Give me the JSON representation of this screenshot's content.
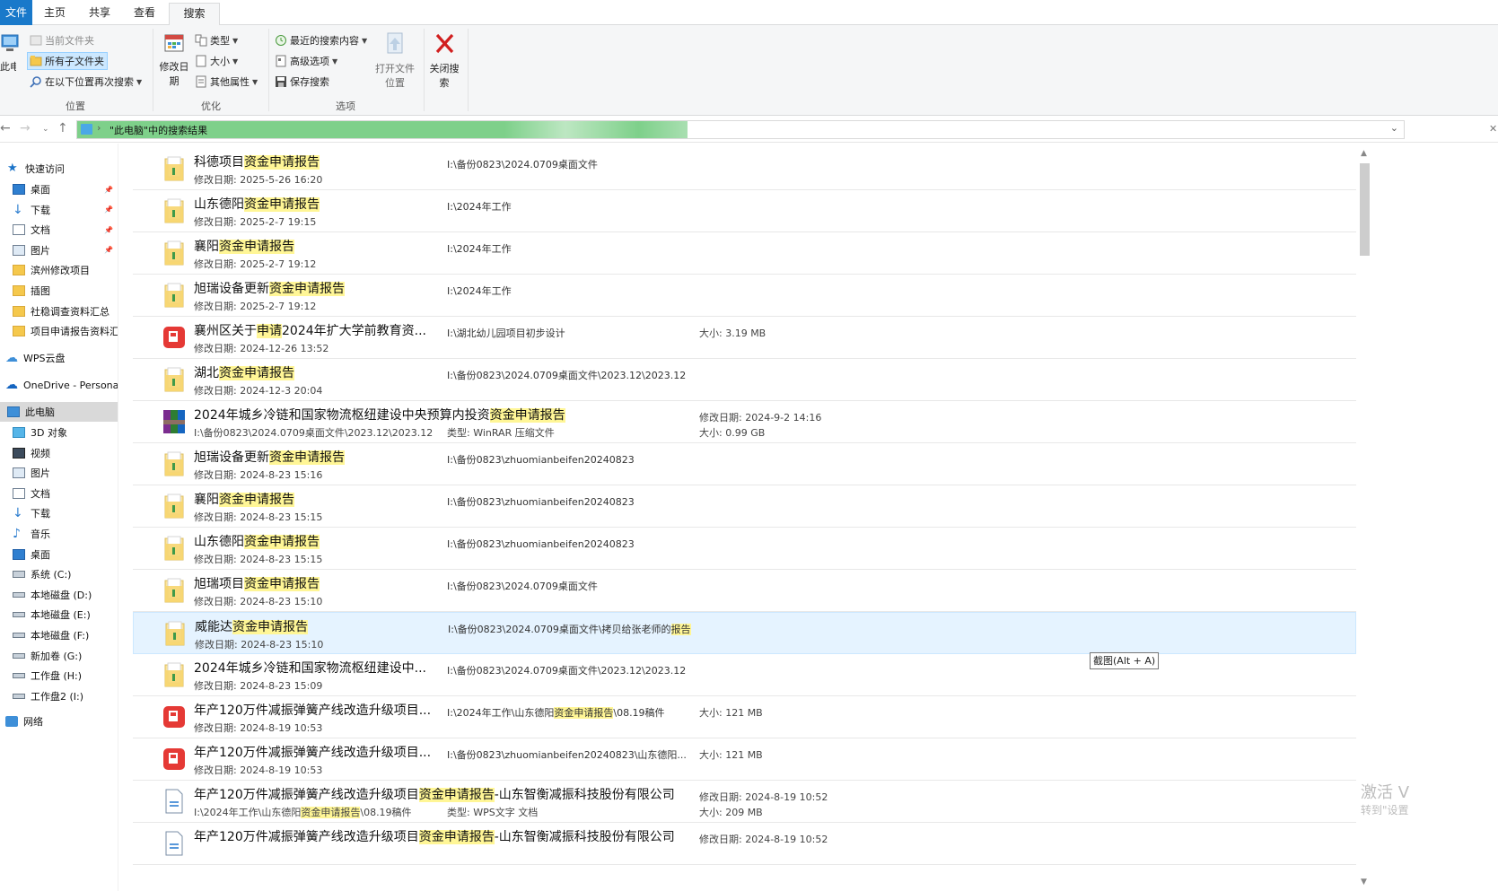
{
  "ribbon_tabs": [
    {
      "label": "文件"
    },
    {
      "label": "主页"
    },
    {
      "label": "共享"
    },
    {
      "label": "查看"
    },
    {
      "label": "搜索"
    }
  ],
  "ribbon": {
    "location": {
      "this_pc": "此电脑",
      "current_folder": "当前文件夹",
      "all_subfolders": "所有子文件夹",
      "search_again_in": "在以下位置再次搜索",
      "group_label": "位置"
    },
    "refine": {
      "date_modified": "修改日期",
      "kind": "类型",
      "size": "大小",
      "other_properties": "其他属性",
      "group_label": "优化"
    },
    "options": {
      "recent_searches": "最近的搜索内容",
      "advanced_options": "高级选项",
      "save_search": "保存搜索",
      "open_file_location": "打开文件位置",
      "group_label": "选项"
    },
    "close": {
      "close_search": "关闭搜索"
    }
  },
  "address_bar": {
    "text": "\"此电脑\"中的搜索结果"
  },
  "nav_pane": {
    "quick_access": "快速访问",
    "quick_items": [
      {
        "label": "桌面",
        "icon": "desktop-icon",
        "pinned": true
      },
      {
        "label": "下载",
        "icon": "download-icon",
        "pinned": true
      },
      {
        "label": "文档",
        "icon": "document-icon",
        "pinned": true
      },
      {
        "label": "图片",
        "icon": "picture-icon",
        "pinned": true
      },
      {
        "label": "滨州修改项目",
        "icon": "folder-icon",
        "pinned": false
      },
      {
        "label": "插图",
        "icon": "folder-icon",
        "pinned": false
      },
      {
        "label": "社稳调查资料汇总",
        "icon": "folder-icon",
        "pinned": false
      },
      {
        "label": "项目申请报告资料汇总",
        "icon": "folder-icon",
        "pinned": false
      }
    ],
    "wps_cloud": "WPS云盘",
    "onedrive": "OneDrive - Personal",
    "this_pc": "此电脑",
    "pc_items": [
      {
        "label": "3D 对象",
        "icon": "3d-objects-icon"
      },
      {
        "label": "视频",
        "icon": "video-icon"
      },
      {
        "label": "图片",
        "icon": "picture-icon"
      },
      {
        "label": "文档",
        "icon": "document-icon"
      },
      {
        "label": "下载",
        "icon": "download-icon"
      },
      {
        "label": "音乐",
        "icon": "music-icon"
      },
      {
        "label": "桌面",
        "icon": "desktop-icon"
      },
      {
        "label": "系统 (C:)",
        "icon": "system-drive-icon"
      },
      {
        "label": "本地磁盘 (D:)",
        "icon": "drive-icon"
      },
      {
        "label": "本地磁盘 (E:)",
        "icon": "drive-icon"
      },
      {
        "label": "本地磁盘 (F:)",
        "icon": "drive-icon"
      },
      {
        "label": "新加卷 (G:)",
        "icon": "drive-icon"
      },
      {
        "label": "工作盘 (H:)",
        "icon": "drive-icon"
      },
      {
        "label": "工作盘2 (I:)",
        "icon": "drive-icon"
      }
    ],
    "network": "网络"
  },
  "results": [
    {
      "icon": "folder-icon",
      "name_pre": "科德项目",
      "name_hl": "资金申请报告",
      "name_post": "",
      "sub": "修改日期: 2025-5-26 16:20",
      "path_pre": "I:\\备份0823\\2024.0709桌面文件",
      "path_hl": "",
      "path_post": "",
      "size": ""
    },
    {
      "icon": "folder-icon",
      "name_pre": "山东德阳",
      "name_hl": "资金申请报告",
      "name_post": "",
      "sub": "修改日期: 2025-2-7 19:15",
      "path_pre": "I:\\2024年工作",
      "path_hl": "",
      "path_post": "",
      "size": ""
    },
    {
      "icon": "folder-icon",
      "name_pre": "襄阳",
      "name_hl": "资金申请报告",
      "name_post": "",
      "sub": "修改日期: 2025-2-7 19:12",
      "path_pre": "I:\\2024年工作",
      "path_hl": "",
      "path_post": "",
      "size": ""
    },
    {
      "icon": "folder-icon",
      "name_pre": "旭瑞设备更新",
      "name_hl": "资金申请报告",
      "name_post": "",
      "sub": "修改日期: 2025-2-7 19:12",
      "path_pre": "I:\\2024年工作",
      "path_hl": "",
      "path_post": "",
      "size": ""
    },
    {
      "icon": "pdf-icon",
      "name_pre": "襄州区关于",
      "name_hl": "申请",
      "name_post": "2024年扩大学前教育资...",
      "sub": "修改日期: 2024-12-26 13:52",
      "path_pre": "I:\\湖北幼儿园项目初步设计",
      "path_hl": "",
      "path_post": "",
      "size": "大小: 3.19 MB"
    },
    {
      "icon": "folder-icon",
      "name_pre": "湖北",
      "name_hl": "资金申请报告",
      "name_post": "",
      "sub": "修改日期: 2024-12-3 20:04",
      "path_pre": "I:\\备份0823\\2024.0709桌面文件\\2023.12\\2023.12",
      "path_hl": "",
      "path_post": "",
      "size": ""
    },
    {
      "icon": "winrar-icon",
      "name_pre": "2024年城乡冷链和国家物流枢纽建设中央预算内投资",
      "name_hl": "资金申请报告",
      "name_post": "",
      "sub": "I:\\备份0823\\2024.0709桌面文件\\2023.12\\2023.12",
      "path_pre": "",
      "path_hl": "",
      "path_post": "",
      "path2": "类型: WinRAR 压缩文件",
      "size": "修改日期: 2024-9-2 14:16",
      "size2": "大小: 0.99 GB"
    },
    {
      "icon": "folder-icon",
      "name_pre": "旭瑞设备更新",
      "name_hl": "资金申请报告",
      "name_post": "",
      "sub": "修改日期: 2024-8-23 15:16",
      "path_pre": "I:\\备份0823\\zhuomianbeifen20240823",
      "path_hl": "",
      "path_post": "",
      "size": ""
    },
    {
      "icon": "folder-icon",
      "name_pre": "襄阳",
      "name_hl": "资金申请报告",
      "name_post": "",
      "sub": "修改日期: 2024-8-23 15:15",
      "path_pre": "I:\\备份0823\\zhuomianbeifen20240823",
      "path_hl": "",
      "path_post": "",
      "size": ""
    },
    {
      "icon": "folder-icon",
      "name_pre": "山东德阳",
      "name_hl": "资金申请报告",
      "name_post": "",
      "sub": "修改日期: 2024-8-23 15:15",
      "path_pre": "I:\\备份0823\\zhuomianbeifen20240823",
      "path_hl": "",
      "path_post": "",
      "size": ""
    },
    {
      "icon": "folder-icon",
      "name_pre": "旭瑞项目",
      "name_hl": "资金申请报告",
      "name_post": "",
      "sub": "修改日期: 2024-8-23 15:10",
      "path_pre": "I:\\备份0823\\2024.0709桌面文件",
      "path_hl": "",
      "path_post": "",
      "size": ""
    },
    {
      "icon": "folder-icon",
      "name_pre": "威能达",
      "name_hl": "资金申请报告",
      "name_post": "",
      "sub": "修改日期: 2024-8-23 15:10",
      "path_pre": "I:\\备份0823\\2024.0709桌面文件\\拷贝给张老师的",
      "path_hl": "报告",
      "path_post": "",
      "size": "",
      "hover": true
    },
    {
      "icon": "folder-icon",
      "name_pre": "2024年城乡冷链和国家物流枢纽建设中...",
      "name_hl": "",
      "name_post": "",
      "sub": "修改日期: 2024-8-23 15:09",
      "path_pre": "I:\\备份0823\\2024.0709桌面文件\\2023.12\\2023.12",
      "path_hl": "",
      "path_post": "",
      "size": ""
    },
    {
      "icon": "pdf-icon",
      "name_pre": "年产120万件减振弹簧产线改造升级项目...",
      "name_hl": "",
      "name_post": "",
      "sub": "修改日期: 2024-8-19 10:53",
      "path_pre": "I:\\2024年工作\\山东德阳",
      "path_hl": "资金申请报告",
      "path_post": "\\08.19稿件",
      "size": "大小: 121 MB"
    },
    {
      "icon": "pdf-icon",
      "name_pre": "年产120万件减振弹簧产线改造升级项目...",
      "name_hl": "",
      "name_post": "",
      "sub": "修改日期: 2024-8-19 10:53",
      "path_pre": "I:\\备份0823\\zhuomianbeifen20240823\\山东德阳...",
      "path_hl": "",
      "path_post": "",
      "size": "大小: 121 MB"
    },
    {
      "icon": "wps-doc-icon",
      "name_pre": "年产120万件减振弹簧产线改造升级项目",
      "name_hl": "资金申请报告",
      "name_post": "-山东智衡减振科技股份有限公司",
      "sub_pre": "I:\\2024年工作\\山东德阳",
      "sub_hl": "资金申请报告",
      "sub_post": "\\08.19稿件",
      "path_pre": "",
      "path_hl": "",
      "path_post": "",
      "path2": "类型: WPS文字 文档",
      "size": "修改日期: 2024-8-19 10:52",
      "size2": "大小: 209 MB"
    },
    {
      "icon": "wps-doc-icon",
      "name_pre": "年产120万件减振弹簧产线改造升级项目",
      "name_hl": "资金申请报告",
      "name_post": "-山东智衡减振科技股份有限公司",
      "sub": "",
      "path_pre": "",
      "path_hl": "",
      "path_post": "",
      "size": "修改日期: 2024-8-19 10:52"
    }
  ],
  "tooltip": "截图(Alt + A)",
  "watermark": {
    "line1": "激活 V",
    "line2": "转到\"设置"
  }
}
